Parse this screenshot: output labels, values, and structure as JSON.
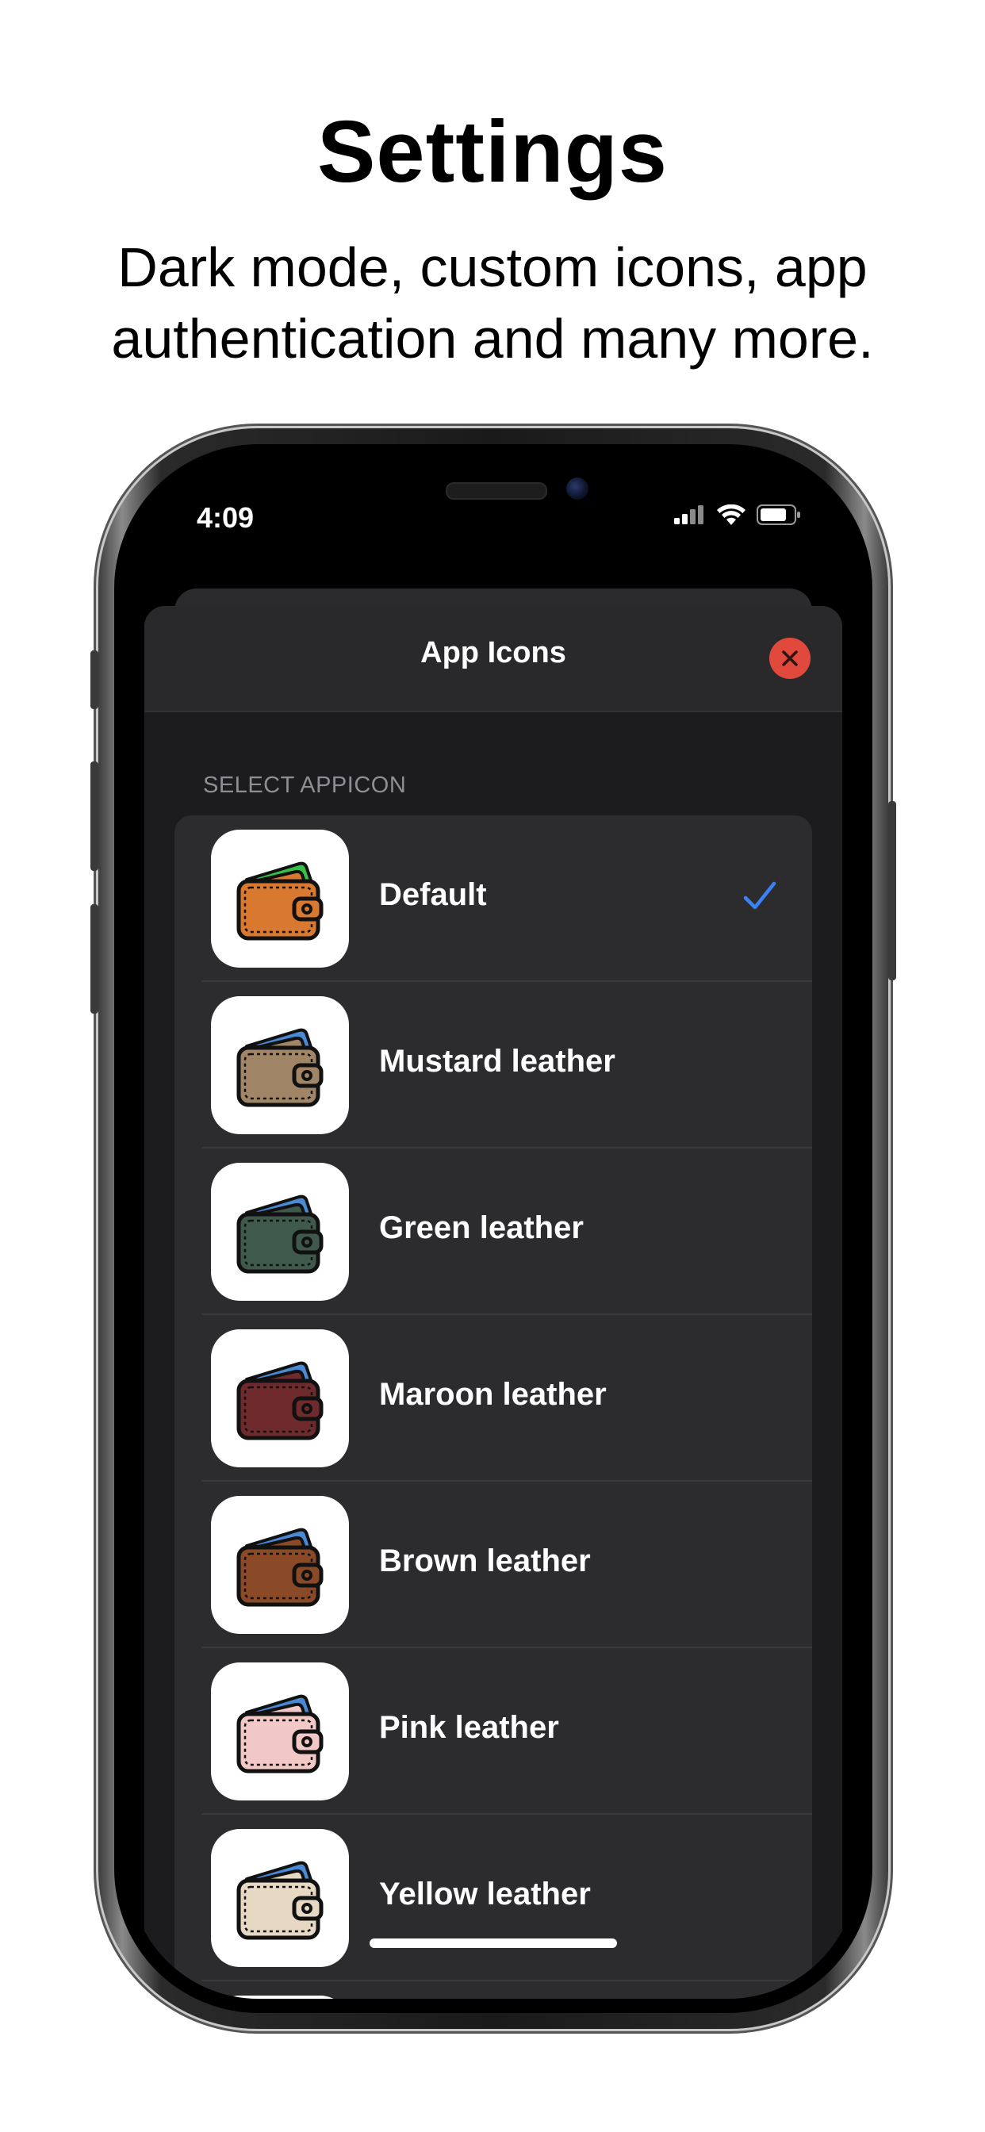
{
  "marketing": {
    "headline": "Settings",
    "subhead": "Dark mode, custom icons, app authentication and many more."
  },
  "status_bar": {
    "time": "4:09",
    "icons": [
      "cellular-signal-icon",
      "wifi-icon",
      "battery-icon"
    ]
  },
  "modal": {
    "title": "App Icons",
    "close_icon": "close-icon",
    "close_color": "#e2493d"
  },
  "section": {
    "label": "SELECT APPICON"
  },
  "accent_color": "#3b82f6",
  "app_icons": [
    {
      "label": "Default",
      "selected": true,
      "leather_color": "#d9782f",
      "card_color": "#35c04a"
    },
    {
      "label": "Mustard leather",
      "selected": false,
      "leather_color": "#a08566",
      "card_color": "#4a8ad4"
    },
    {
      "label": "Green leather",
      "selected": false,
      "leather_color": "#3f5a4c",
      "card_color": "#4a8ad4"
    },
    {
      "label": "Maroon leather",
      "selected": false,
      "leather_color": "#6e2a2c",
      "card_color": "#4a8ad4"
    },
    {
      "label": "Brown leather",
      "selected": false,
      "leather_color": "#8a4a28",
      "card_color": "#4a8ad4"
    },
    {
      "label": "Pink leather",
      "selected": false,
      "leather_color": "#f2c8c6",
      "card_color": "#4a8ad4"
    },
    {
      "label": "Yellow leather",
      "selected": false,
      "leather_color": "#e7d8c4",
      "card_color": "#4a8ad4"
    },
    {
      "label": "",
      "selected": false,
      "leather_color": "#111111",
      "card_color": "#4a8ad4"
    }
  ]
}
